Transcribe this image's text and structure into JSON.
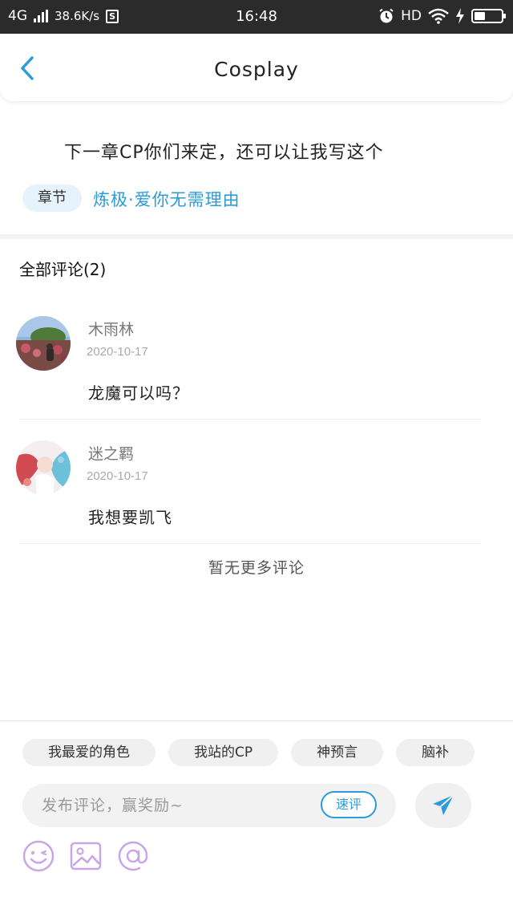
{
  "status_bar": {
    "network": "4G",
    "speed": "38.6K/s",
    "s_icon": "S",
    "time": "16:48",
    "hd": "HD",
    "battery_level": 0.4
  },
  "header": {
    "title": "Cosplay",
    "back_icon": "chevron-left-icon"
  },
  "post": {
    "text": "下一章CP你们来定，还可以让我写这个",
    "chapter_tag": "章节",
    "chapter_title": "炼极·爱你无需理由"
  },
  "comments_section": {
    "title": "全部评论(2)",
    "comments": [
      {
        "name": "木雨林",
        "date": "2020-10-17",
        "text": "龙魔可以吗？"
      },
      {
        "name": "迷之羁",
        "date": "2020-10-17",
        "text": "我想要凯飞"
      }
    ],
    "no_more": "暂无更多评论"
  },
  "composer": {
    "chips": [
      "我最爱的角色",
      "我站的CP",
      "神预言",
      "脑补"
    ],
    "placeholder": "发布评论，赢奖励~",
    "quick_comment": "速评",
    "send_icon": "send-icon",
    "tools": [
      "emoji-icon",
      "image-icon",
      "mention-icon"
    ]
  },
  "colors": {
    "accent": "#2b9bd9",
    "status_bar": "#2b2b2b",
    "chip_bg": "#f0f0f0",
    "tool_icon": "#c9a6e8"
  }
}
